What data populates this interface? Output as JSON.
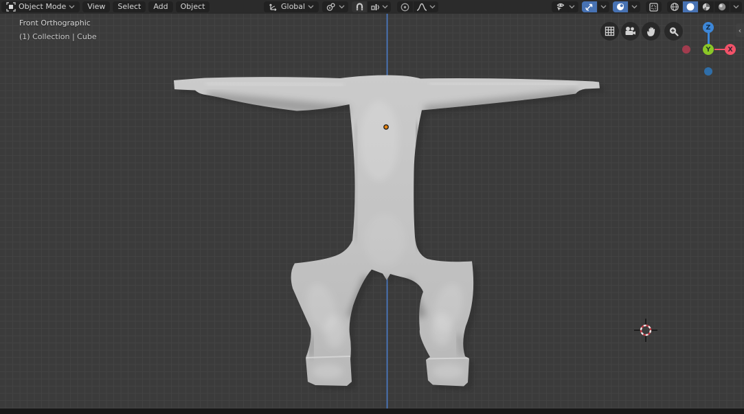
{
  "header": {
    "mode_selector": {
      "label": "Object Mode",
      "icon": "object-mode-icon"
    },
    "menus": [
      {
        "label": "View"
      },
      {
        "label": "Select"
      },
      {
        "label": "Add"
      },
      {
        "label": "Object"
      }
    ],
    "orientation": {
      "label": "Global",
      "icon": "transform-orientation-icon"
    },
    "tool_icons": [
      "pivot-point-icon",
      "snap-magnet-icon",
      "snap-target-icon",
      "proportional-editing-icon",
      "falloff-curve-icon",
      "visibility-filter-icon",
      "gizmo-toggle-icon",
      "overlays-toggle-icon",
      "xray-toggle-icon",
      "shading-wireframe-icon",
      "shading-solid-icon",
      "shading-material-icon",
      "shading-rendered-icon"
    ]
  },
  "viewport": {
    "view_label": "Front Orthographic",
    "breadcrumb": "(1) Collection | Cube",
    "nav_icons": [
      "grid-icon",
      "camera-icon",
      "pan-hand-icon",
      "zoom-icon"
    ],
    "gizmo": {
      "z_label": "Z",
      "y_label": "Y",
      "x_label": "X"
    },
    "collapse_arrow": "‹"
  },
  "colors": {
    "accent_blue": "#4772b3",
    "axis_x": "#f25268",
    "axis_y": "#8bc727",
    "axis_z": "#3d87d8",
    "neg_x": "#a13c4e",
    "neg_z": "#2f6ea8",
    "z_axis_line": "#4a7fd0",
    "origin_orange": "#e8830e",
    "viewport_bg": "#3b3b3b",
    "grid_line": "#434343"
  }
}
